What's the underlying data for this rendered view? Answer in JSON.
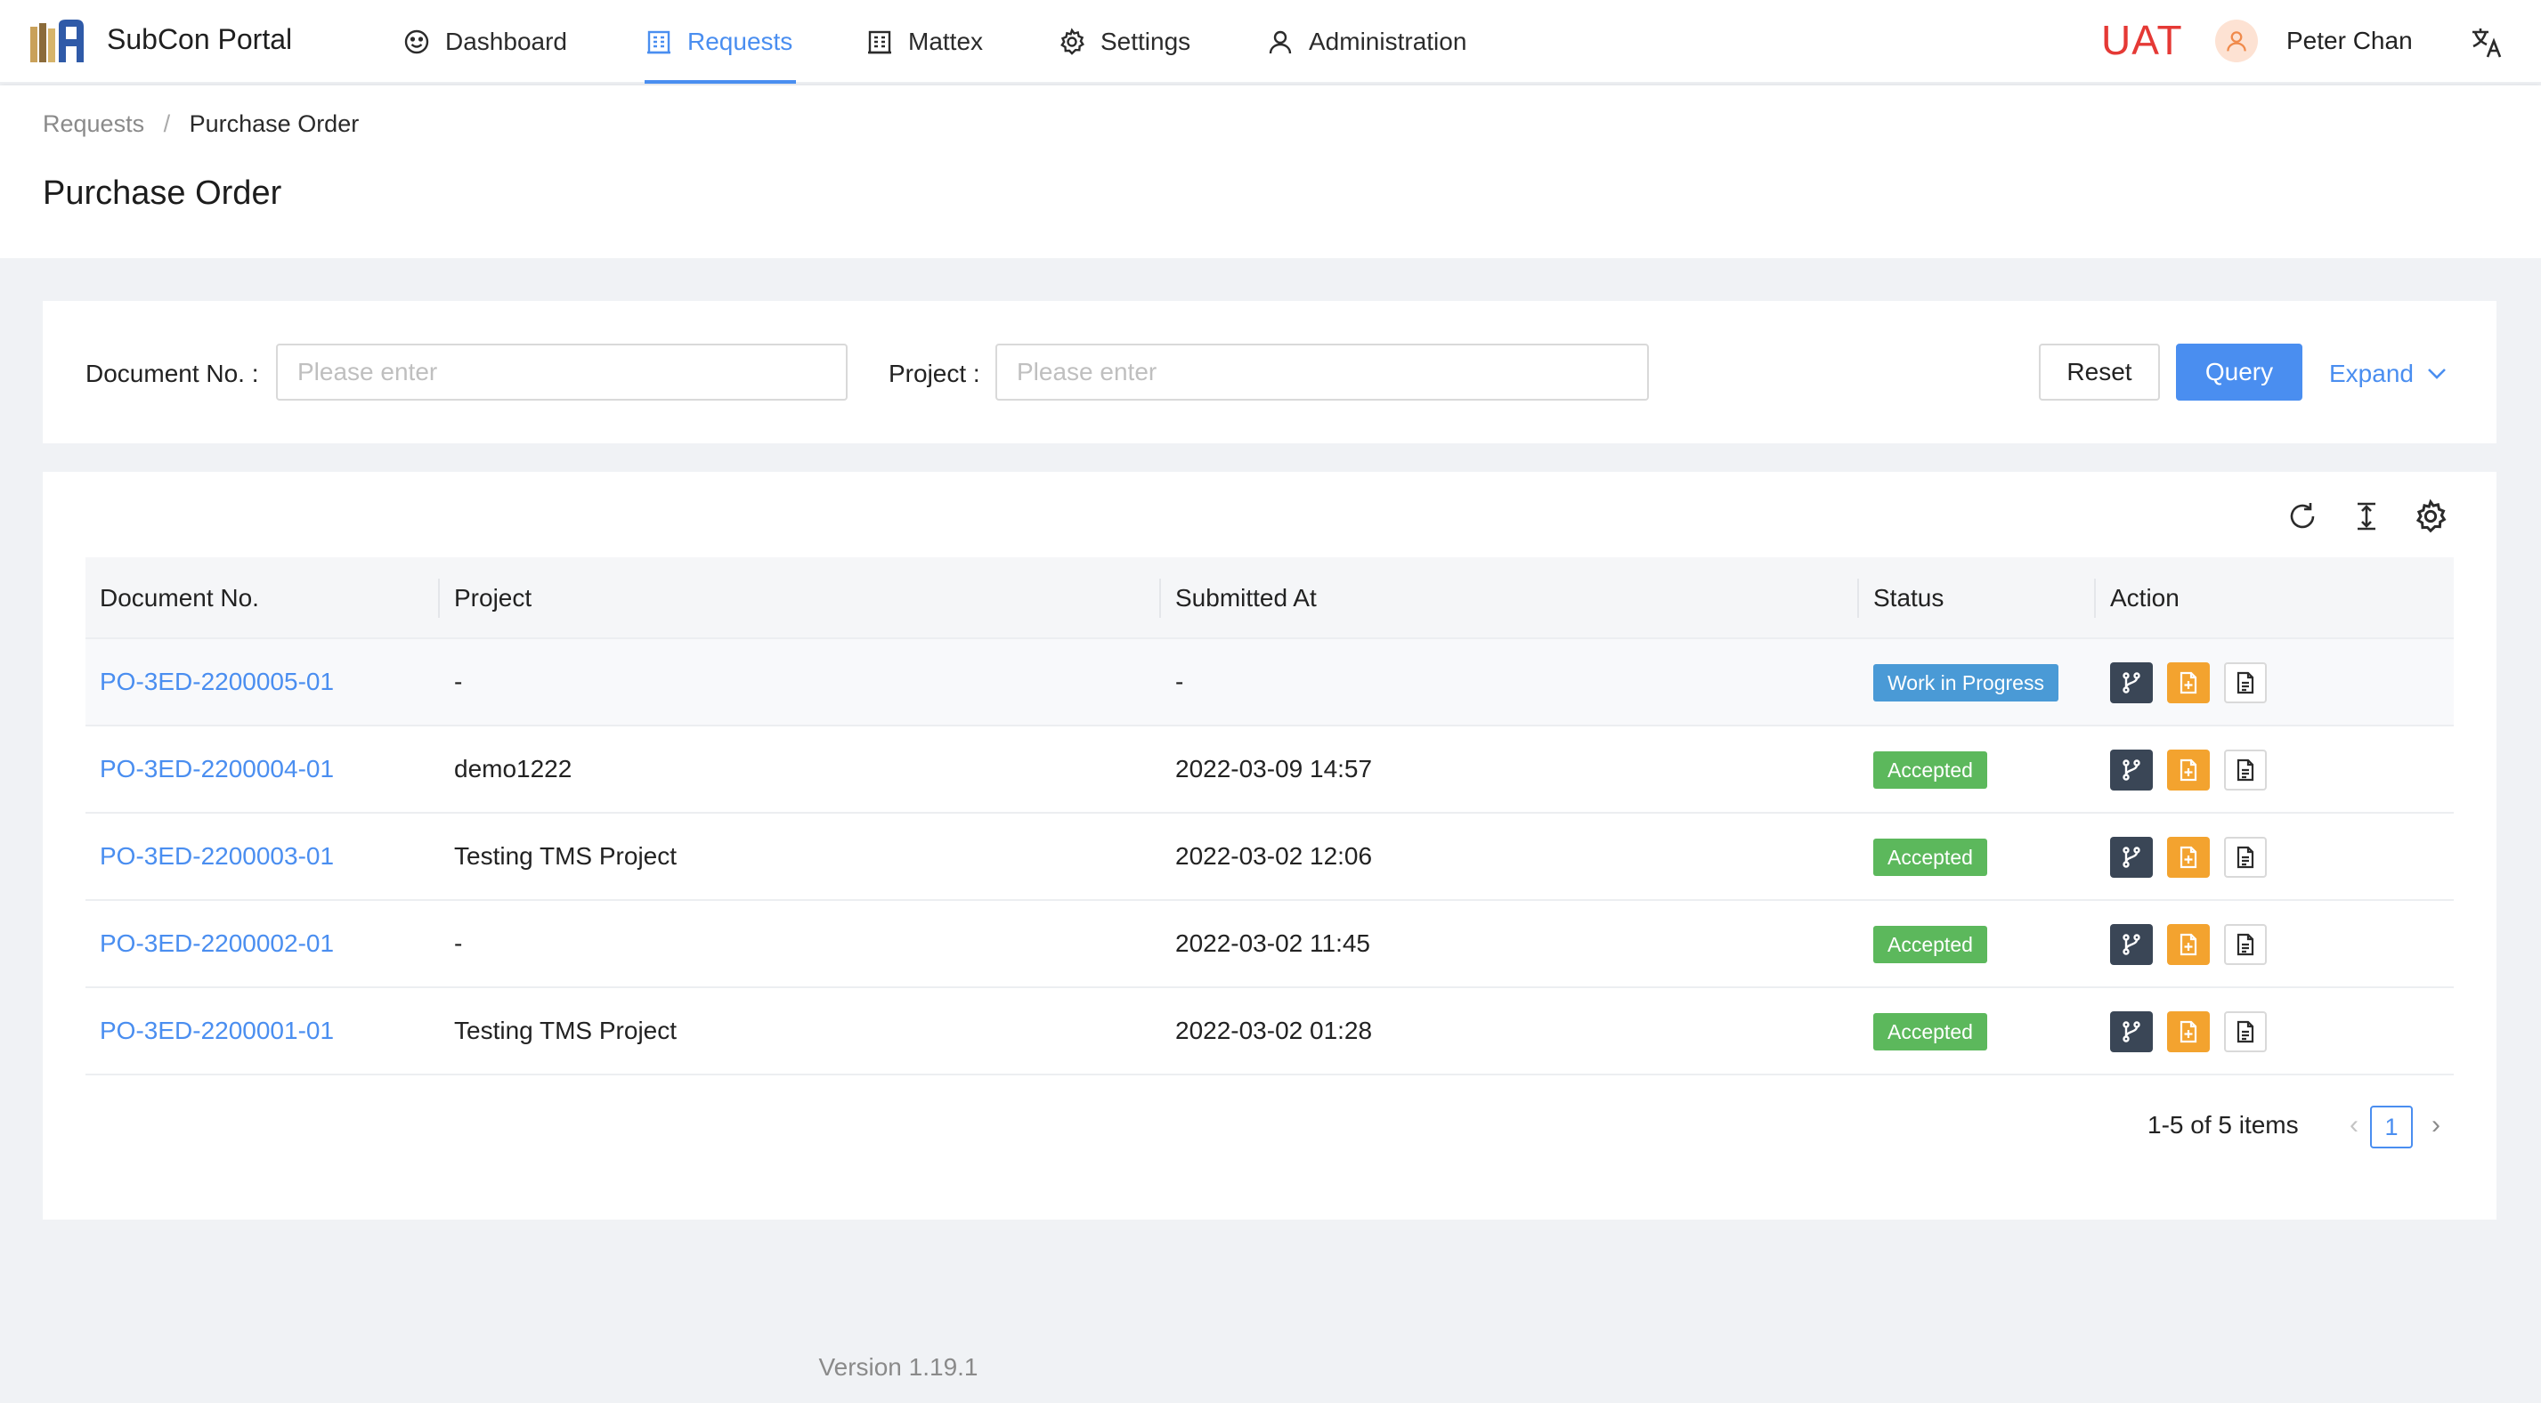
{
  "app": {
    "brand": "SubCon Portal",
    "environment": "UAT",
    "user": "Peter Chan",
    "colors": {
      "accent": "#4a8ef0",
      "uat": "#e53935",
      "wip": "#4a9ad6",
      "accepted": "#5cb85c"
    }
  },
  "nav": {
    "items": [
      {
        "label": "Dashboard",
        "icon": "smile-icon"
      },
      {
        "label": "Requests",
        "icon": "building-icon",
        "active": true
      },
      {
        "label": "Mattex",
        "icon": "building-icon"
      },
      {
        "label": "Settings",
        "icon": "gear-icon"
      },
      {
        "label": "Administration",
        "icon": "user-icon"
      }
    ]
  },
  "breadcrumb": {
    "parent": "Requests",
    "separator": "/",
    "current": "Purchase Order"
  },
  "page": {
    "title": "Purchase Order"
  },
  "filters": {
    "document_label": "Document No.",
    "document_placeholder": "Please enter",
    "project_label": "Project",
    "project_placeholder": "Please enter",
    "reset_label": "Reset",
    "query_label": "Query",
    "expand_label": "Expand"
  },
  "table": {
    "columns": [
      "Document No.",
      "Project",
      "Submitted At",
      "Status",
      "Action"
    ],
    "rows": [
      {
        "doc": "PO-3ED-2200005-01",
        "project": "-",
        "submitted": "-",
        "status": "Work in Progress",
        "status_type": "wip"
      },
      {
        "doc": "PO-3ED-2200004-01",
        "project": "demo1222",
        "submitted": "2022-03-09 14:57",
        "status": "Accepted",
        "status_type": "accepted"
      },
      {
        "doc": "PO-3ED-2200003-01",
        "project": "Testing TMS Project",
        "submitted": "2022-03-02 12:06",
        "status": "Accepted",
        "status_type": "accepted"
      },
      {
        "doc": "PO-3ED-2200002-01",
        "project": "-",
        "submitted": "2022-03-02 11:45",
        "status": "Accepted",
        "status_type": "accepted"
      },
      {
        "doc": "PO-3ED-2200001-01",
        "project": "Testing TMS Project",
        "submitted": "2022-03-02 01:28",
        "status": "Accepted",
        "status_type": "accepted"
      }
    ]
  },
  "pagination": {
    "total_text": "1-5 of 5 items",
    "current_page": "1",
    "prev": "‹",
    "next": "›"
  },
  "footer": {
    "version": "Version 1.19.1"
  }
}
